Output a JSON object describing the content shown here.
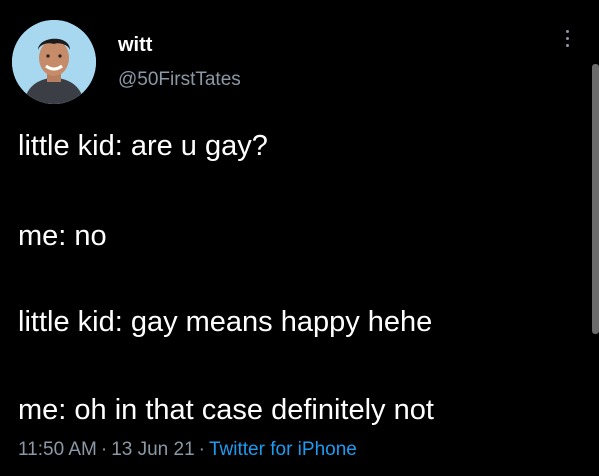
{
  "author": {
    "display_name": "witt",
    "handle": "@50FirstTates"
  },
  "tweet": {
    "lines": [
      "little kid: are u gay?",
      "me: no",
      "little kid: gay means happy hehe",
      "me: oh in that case definitely not"
    ],
    "time": "11:50 AM",
    "date": "13 Jun 21",
    "source": "Twitter for iPhone",
    "separator": "·"
  },
  "icons": {
    "more": "more-vertical-icon",
    "avatar": "profile-avatar"
  },
  "colors": {
    "background": "#000000",
    "text": "#ffffff",
    "secondary": "#8b98a5",
    "link": "#1d9bf0"
  }
}
